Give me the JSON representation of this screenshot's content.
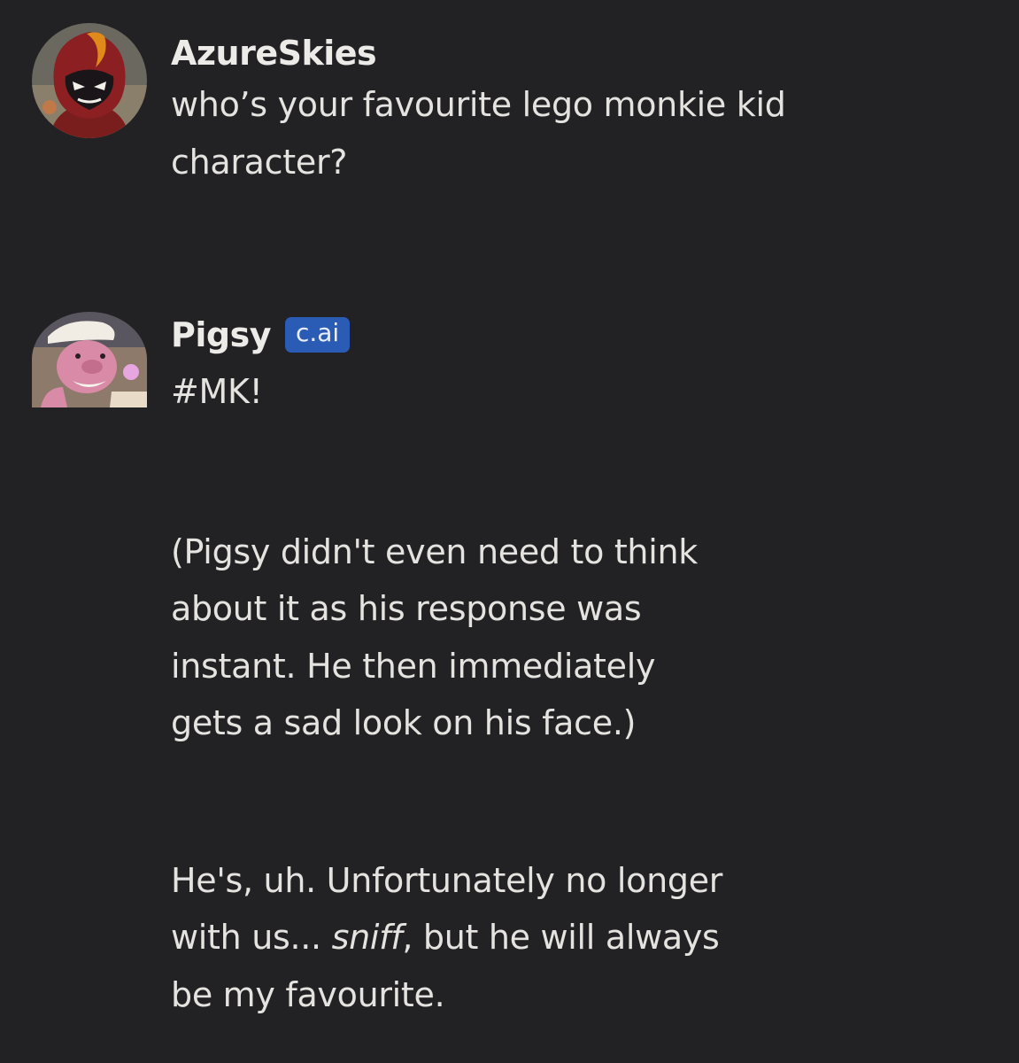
{
  "messages": [
    {
      "author": "AzureSkies",
      "text_lines": [
        "who’s your favourite lego monkie kid",
        "character?"
      ]
    },
    {
      "author": "Pigsy",
      "badge": "c.ai",
      "paragraphs": [
        {
          "lines": [
            "#MK!"
          ]
        },
        {
          "lines": [
            "(Pigsy didn't even need to think",
            "about it as his response was",
            "instant. He then immediately",
            "gets a sad look on his face.)"
          ]
        },
        {
          "lines_html": true,
          "line1": "He's, uh. Unfortunately no longer",
          "line2_before": "with us... ",
          "line2_em": "sniff",
          "line2_after": ", but he will always",
          "line3": "be my favourite."
        }
      ]
    }
  ],
  "colors": {
    "background": "#222224",
    "text": "#e4e3df",
    "badge_bg": "#2a5bb5"
  },
  "icons": {
    "user_avatar": "villain-character-avatar",
    "bot_avatar": "pig-chef-avatar"
  }
}
